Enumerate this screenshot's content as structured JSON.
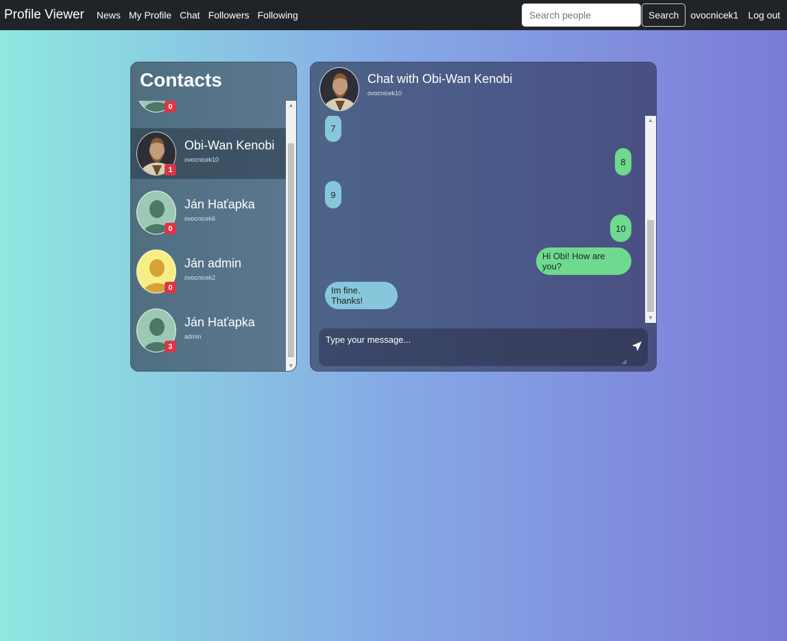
{
  "navbar": {
    "brand": "Profile Viewer",
    "links": [
      "News",
      "My Profile",
      "Chat",
      "Followers",
      "Following"
    ],
    "search_placeholder": "Search people",
    "search_button": "Search",
    "username": "ovocnicek1",
    "logout": "Log out"
  },
  "contacts": {
    "title": "Contacts",
    "partial_badge": "0",
    "items": [
      {
        "name": "Obi-Wan Kenobi",
        "username": "ovocnicek10",
        "badge": "1",
        "active": true,
        "avatar": "photo"
      },
      {
        "name": "Ján Haťapka",
        "username": "ovocnicek6",
        "badge": "0",
        "active": false,
        "avatar": "default-green"
      },
      {
        "name": "Ján admin",
        "username": "ovocnicek2",
        "badge": "0",
        "active": false,
        "avatar": "default-yellow"
      },
      {
        "name": "Ján Haťapka",
        "username": "admin",
        "badge": "3",
        "active": false,
        "avatar": "default-green"
      }
    ]
  },
  "chat": {
    "title": "Chat with Obi-Wan Kenobi",
    "subtitle": "ovocnicek10",
    "messages": [
      {
        "text": "7",
        "direction": "in"
      },
      {
        "text": "8",
        "direction": "out"
      },
      {
        "text": "9",
        "direction": "in"
      },
      {
        "text": "10",
        "direction": "out"
      },
      {
        "text": "Hi Obi! How are you?",
        "direction": "out"
      },
      {
        "text": "Im fine. Thanks!",
        "direction": "in"
      }
    ],
    "composer_placeholder": "Type your message..."
  },
  "colors": {
    "navbar": "#202328",
    "badge": "#dc3545",
    "incoming_bubble": "#86c7dc",
    "outgoing_bubble": "#6fda8f"
  }
}
